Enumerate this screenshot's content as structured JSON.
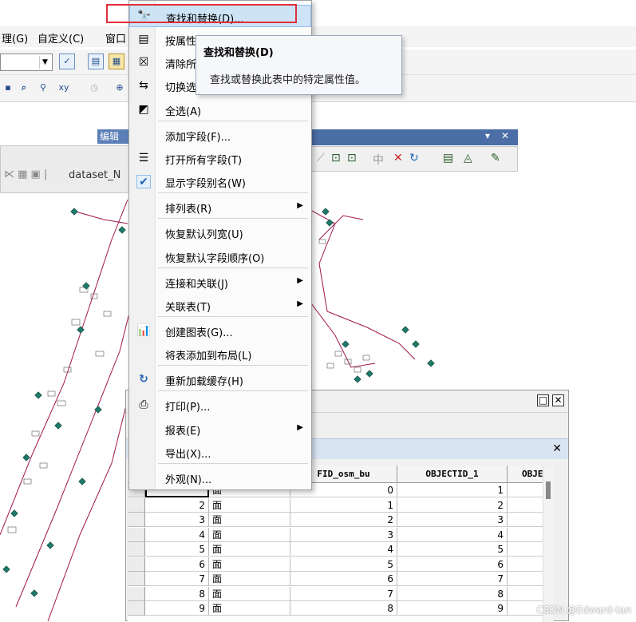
{
  "menubar": {
    "items": [
      "理(G)",
      "自定义(C)",
      "窗口"
    ]
  },
  "dataset_tab": "dataset_N",
  "editor_label": "编辑",
  "context_menu": {
    "items": [
      {
        "label": "查找和替换(D)...",
        "icon": "binoculars-icon",
        "highlighted": true
      },
      {
        "label": "按属性",
        "icon": "select-by-attributes-icon"
      },
      {
        "label": "清除所",
        "icon": "clear-selection-icon"
      },
      {
        "label": "切换选",
        "icon": "switch-selection-icon"
      },
      {
        "label": "全选(A)",
        "icon": "select-all-icon"
      },
      {
        "label": "添加字段(F)...",
        "icon": ""
      },
      {
        "label": "打开所有字段(T)",
        "icon": "fields-icon"
      },
      {
        "label": "显示字段别名(W)",
        "icon": "checkmark-icon",
        "checked": true
      },
      {
        "label": "排列表(R)",
        "icon": "",
        "submenu": true
      },
      {
        "label": "恢复默认列宽(U)",
        "icon": ""
      },
      {
        "label": "恢复默认字段顺序(O)",
        "icon": ""
      },
      {
        "label": "连接和关联(J)",
        "icon": "",
        "submenu": true
      },
      {
        "label": "关联表(T)",
        "icon": "",
        "submenu": true
      },
      {
        "label": "创建图表(G)...",
        "icon": "bar-chart-icon"
      },
      {
        "label": "将表添加到布局(L)",
        "icon": ""
      },
      {
        "label": "重新加载缓存(H)",
        "icon": "reload-icon"
      },
      {
        "label": "打印(P)...",
        "icon": "printer-icon"
      },
      {
        "label": "报表(E)",
        "icon": "",
        "submenu": true
      },
      {
        "label": "导出(X)...",
        "icon": ""
      },
      {
        "label": "外观(N)...",
        "icon": ""
      }
    ]
  },
  "tooltip": {
    "title": "查找和替换(D)",
    "description": "查找或替换此表中的特定属性值。"
  },
  "table": {
    "columns": [
      "FID_osm_bu",
      "OBJECTID_1",
      "OBJE"
    ],
    "rows": [
      {
        "fid": "",
        "shape": "面",
        "fid_osm": "0",
        "objectid": "1"
      },
      {
        "fid": "2",
        "shape": "面",
        "fid_osm": "1",
        "objectid": "2"
      },
      {
        "fid": "3",
        "shape": "面",
        "fid_osm": "2",
        "objectid": "3"
      },
      {
        "fid": "4",
        "shape": "面",
        "fid_osm": "3",
        "objectid": "4"
      },
      {
        "fid": "5",
        "shape": "面",
        "fid_osm": "4",
        "objectid": "5"
      },
      {
        "fid": "6",
        "shape": "面",
        "fid_osm": "5",
        "objectid": "6"
      },
      {
        "fid": "7",
        "shape": "面",
        "fid_osm": "6",
        "objectid": "7"
      },
      {
        "fid": "8",
        "shape": "面",
        "fid_osm": "7",
        "objectid": "8"
      },
      {
        "fid": "9",
        "shape": "面",
        "fid_osm": "8",
        "objectid": "9"
      }
    ]
  },
  "watermark": "CSDN @Edward-tan",
  "colors": {
    "highlight": "#cde4f7",
    "red_box": "#e0303a",
    "map_line": "#a0154f",
    "map_point": "#1d7a6a"
  }
}
